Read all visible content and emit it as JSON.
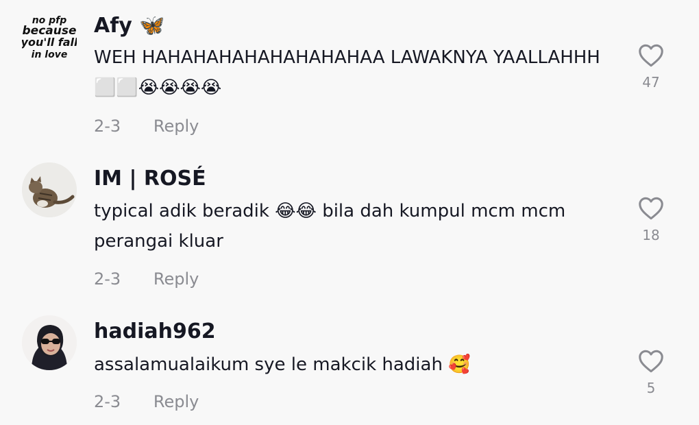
{
  "comments": [
    {
      "username": "Afy 🦋",
      "avatar_text": [
        "no pfp",
        "because",
        "you'll fall",
        "in love"
      ],
      "text": "WEH HAHAHAHAHAHAHAHAHAA LAWAKNYA YAALLAHHH ⬜⬜😭😭😭😭",
      "date": "2-3",
      "reply_label": "Reply",
      "likes": "47"
    },
    {
      "username": "IM | ROSÉ",
      "text": "typical adik beradik 😂😂 bila dah kumpul mcm mcm perangai kluar",
      "date": "2-3",
      "reply_label": "Reply",
      "likes": "18"
    },
    {
      "username": "hadiah962",
      "text": "assalamualaikum sye le makcik hadiah 🥰",
      "date": "2-3",
      "reply_label": "Reply",
      "likes": "5"
    }
  ]
}
